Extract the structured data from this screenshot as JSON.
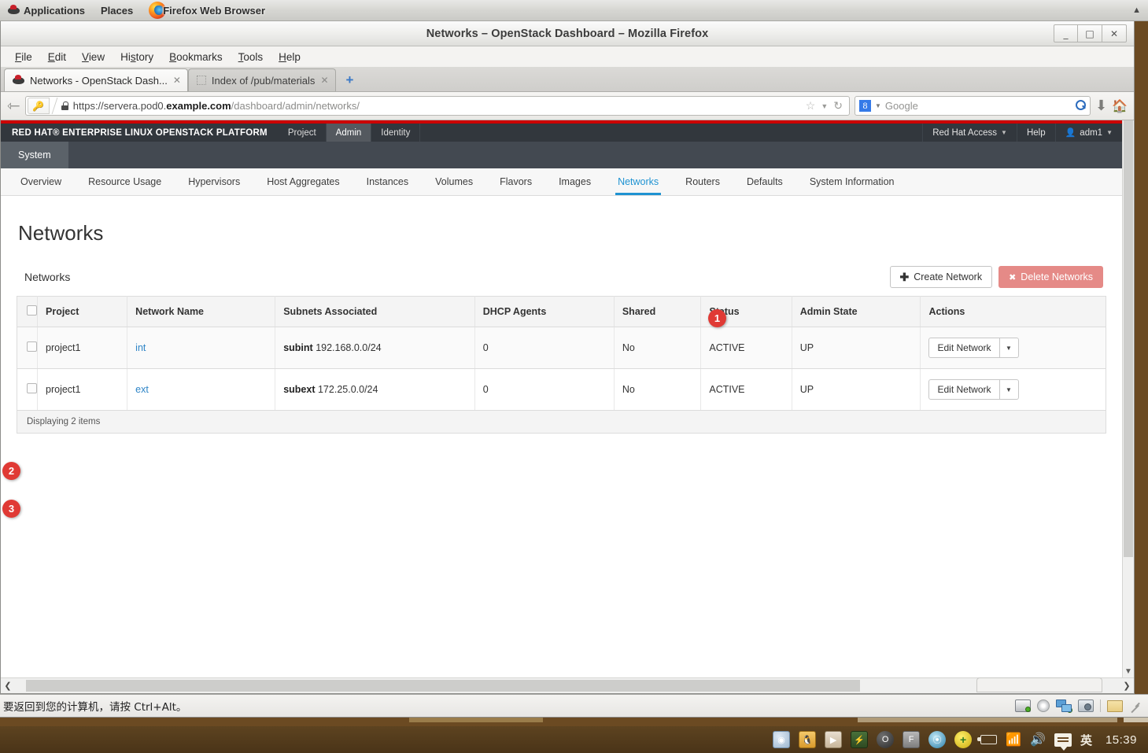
{
  "gnome_panel": {
    "applications": "Applications",
    "places": "Places",
    "window_label": "Firefox Web Browser",
    "redhat_icon": "redhat-icon",
    "firefox_icon": "firefox-icon",
    "collapse_icon": "chevron-up-icon"
  },
  "browser": {
    "window_title": "Networks – OpenStack Dashboard – Mozilla Firefox",
    "minimize_label": "_",
    "maximize_label": "□",
    "close_label": "✕",
    "menus": [
      "File",
      "Edit",
      "View",
      "History",
      "Bookmarks",
      "Tools",
      "Help"
    ],
    "tabs": [
      {
        "title": "Networks - OpenStack Dash...",
        "active": true,
        "favicon": "redhat-icon",
        "close": "✕"
      },
      {
        "title": "Index of /pub/materials",
        "active": false,
        "favicon": "blank-favicon",
        "close": "✕"
      }
    ],
    "new_tab_label": "+",
    "back_icon": "back-arrow-icon",
    "url": {
      "scheme": "https://servera.pod0.",
      "domain": "example.com",
      "path": "/dashboard/admin/networks/",
      "lock_icon": "lock-icon",
      "identity_icon": "identity-key-icon",
      "bookmark_icon": "star-icon",
      "dropdown_icon": "chevron-down-icon",
      "reload_icon": "reload-icon"
    },
    "search": {
      "engine_icon": "google-icon",
      "engine_letter": "8",
      "placeholder": "Google",
      "value": "",
      "submit_icon": "magnifier-icon",
      "dropdown_icon": "chevron-down-icon"
    },
    "download_icon": "download-arrow-icon",
    "home_icon": "home-icon"
  },
  "openstack": {
    "brand": "RED HAT® ENTERPRISE LINUX OPENSTACK PLATFORM",
    "primary_nav": [
      {
        "label": "Project",
        "active": false
      },
      {
        "label": "Admin",
        "active": true
      },
      {
        "label": "Identity",
        "active": false
      }
    ],
    "right_nav": {
      "access_label": "Red Hat Access",
      "help_label": "Help",
      "user_label": "adm1",
      "user_icon": "user-icon",
      "caret_icon": "chevron-down-icon"
    },
    "panel_label": "System",
    "tabs": [
      {
        "label": "Overview",
        "active": false
      },
      {
        "label": "Resource Usage",
        "active": false
      },
      {
        "label": "Hypervisors",
        "active": false
      },
      {
        "label": "Host Aggregates",
        "active": false
      },
      {
        "label": "Instances",
        "active": false
      },
      {
        "label": "Volumes",
        "active": false
      },
      {
        "label": "Flavors",
        "active": false
      },
      {
        "label": "Images",
        "active": false
      },
      {
        "label": "Networks",
        "active": true
      },
      {
        "label": "Routers",
        "active": false
      },
      {
        "label": "Defaults",
        "active": false
      },
      {
        "label": "System Information",
        "active": false
      }
    ],
    "page_title": "Networks",
    "table_caption": "Networks",
    "create_button": "Create Network",
    "create_icon": "plus-icon",
    "delete_button": "Delete Networks",
    "delete_icon": "x-icon",
    "columns": [
      "Project",
      "Network Name",
      "Subnets Associated",
      "DHCP Agents",
      "Shared",
      "Status",
      "Admin State",
      "Actions"
    ],
    "rows": [
      {
        "project": "project1",
        "network_name": "int",
        "subnet_name": "subint",
        "subnet_cidr": "192.168.0.0/24",
        "dhcp_agents": "0",
        "shared": "No",
        "status": "ACTIVE",
        "admin_state": "UP",
        "action_label": "Edit Network",
        "action_caret": "▼"
      },
      {
        "project": "project1",
        "network_name": "ext",
        "subnet_name": "subext",
        "subnet_cidr": "172.25.0.0/24",
        "dhcp_agents": "0",
        "shared": "No",
        "status": "ACTIVE",
        "admin_state": "UP",
        "action_label": "Edit Network",
        "action_caret": "▼"
      }
    ],
    "footer": "Displaying 2 items"
  },
  "annotations": [
    {
      "number": "1",
      "target": "networks-tab"
    },
    {
      "number": "2",
      "target": "row-int"
    },
    {
      "number": "3",
      "target": "row-ext"
    }
  ],
  "scrollbars": {
    "v_down_icon": "chevron-down-icon",
    "h_left_icon": "chevron-left-icon",
    "h_right_icon": "chevron-right-icon"
  },
  "vbox_status": {
    "message": "要返回到您的计算机，请按 Ctrl+Alt。",
    "icons": [
      "hard-disk-icon",
      "cd-icon",
      "network-icon",
      "camera-icon",
      "shared-folder-icon"
    ],
    "resize_grip": "resize-grip-icon"
  },
  "taskbar": {
    "icons": [
      "compass-icon",
      "qq-penguin-icon",
      "copy-files-icon",
      "nvidia-icon",
      "opera-icon",
      "f-key-icon",
      "browser-icon",
      "update-icon"
    ],
    "battery_icon": "battery-icon",
    "wifi_icon": "wifi-icon",
    "volume_icon": "volume-icon",
    "ime_icon": "ime-icon",
    "ime_language": "英",
    "clock": "15:39"
  },
  "colors": {
    "brand_red": "#cc0000",
    "accent_blue": "#1f93d2",
    "badge_red": "#e03a35",
    "header_dark": "#32373d"
  }
}
